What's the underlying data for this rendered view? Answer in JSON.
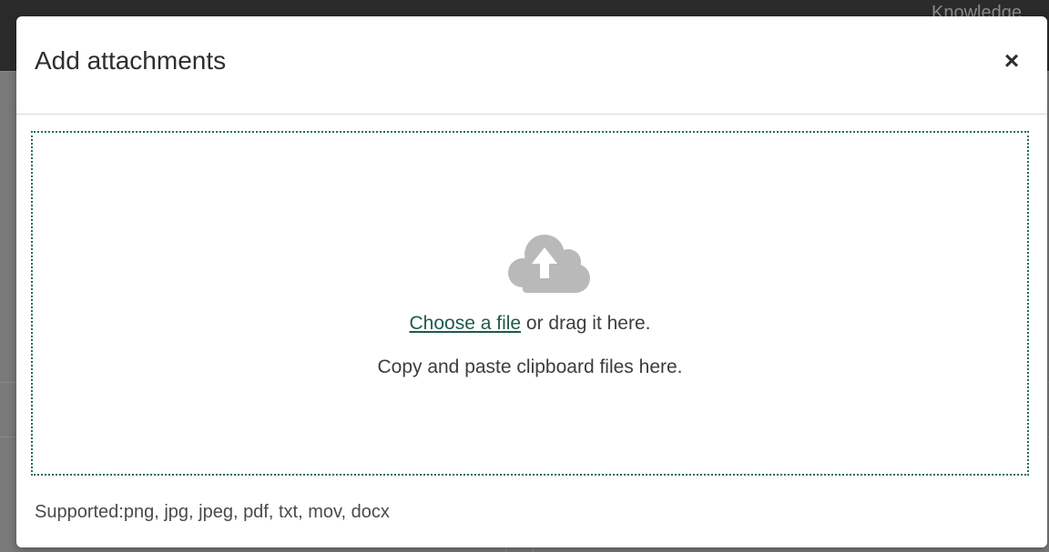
{
  "background": {
    "header_text": "Knowledge"
  },
  "modal": {
    "title": "Add attachments",
    "close_glyph": "×",
    "dropzone": {
      "choose_link": "Choose a file",
      "drag_text": " or drag it here.",
      "paste_text": "Copy and paste clipboard files here.",
      "icon": "cloud-upload-icon"
    },
    "supported_text": "Supported:png, jpg, jpeg, pdf, txt, mov, docx"
  },
  "colors": {
    "accent": "#1f6f5c",
    "link": "#1f5a4b",
    "icon": "#b9b9b9"
  }
}
